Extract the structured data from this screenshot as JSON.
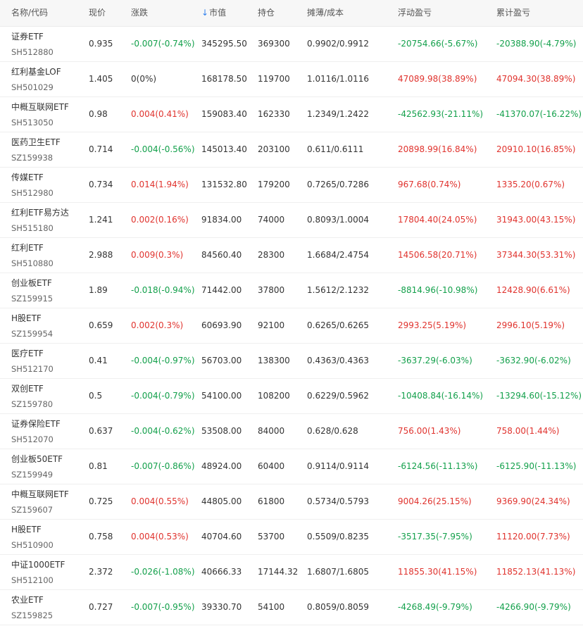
{
  "header": {
    "name_code": "名称/代码",
    "price": "现价",
    "change": "涨跌",
    "sort_arrow": "↓",
    "market_value": "市值",
    "position": "持仓",
    "cost": "摊薄/成本",
    "float_pl": "浮动盈亏",
    "total_pl": "累计盈亏"
  },
  "colors": {
    "up": "#e0332e",
    "down": "#13a04b",
    "sort_accent": "#2f80ed"
  },
  "rows": [
    {
      "name": "证券ETF",
      "code": "SH512880",
      "price": "0.935",
      "change": "-0.007(-0.74%)",
      "mv": "345295.50",
      "pos": "369300",
      "cost": "0.9902/0.9912",
      "float": "-20754.66(-5.67%)",
      "total": "-20388.90(-4.79%)",
      "cs": "neg",
      "fs": "neg",
      "ts": "neg"
    },
    {
      "name": "红利基金LOF",
      "code": "SH501029",
      "price": "1.405",
      "change": "0(0%)",
      "mv": "168178.50",
      "pos": "119700",
      "cost": "1.0116/1.0116",
      "float": "47089.98(38.89%)",
      "total": "47094.30(38.89%)",
      "cs": "flat",
      "fs": "pos",
      "ts": "pos"
    },
    {
      "name": "中概互联网ETF",
      "code": "SH513050",
      "price": "0.98",
      "change": "0.004(0.41%)",
      "mv": "159083.40",
      "pos": "162330",
      "cost": "1.2349/1.2422",
      "float": "-42562.93(-21.11%)",
      "total": "-41370.07(-16.22%)",
      "cs": "pos",
      "fs": "neg",
      "ts": "neg"
    },
    {
      "name": "医药卫生ETF",
      "code": "SZ159938",
      "price": "0.714",
      "change": "-0.004(-0.56%)",
      "mv": "145013.40",
      "pos": "203100",
      "cost": "0.611/0.6111",
      "float": "20898.99(16.84%)",
      "total": "20910.10(16.85%)",
      "cs": "neg",
      "fs": "pos",
      "ts": "pos"
    },
    {
      "name": "传媒ETF",
      "code": "SH512980",
      "price": "0.734",
      "change": "0.014(1.94%)",
      "mv": "131532.80",
      "pos": "179200",
      "cost": "0.7265/0.7286",
      "float": "967.68(0.74%)",
      "total": "1335.20(0.67%)",
      "cs": "pos",
      "fs": "pos",
      "ts": "pos"
    },
    {
      "name": "红利ETF易方达",
      "code": "SH515180",
      "price": "1.241",
      "change": "0.002(0.16%)",
      "mv": "91834.00",
      "pos": "74000",
      "cost": "0.8093/1.0004",
      "float": "17804.40(24.05%)",
      "total": "31943.00(43.15%)",
      "cs": "pos",
      "fs": "pos",
      "ts": "pos"
    },
    {
      "name": "红利ETF",
      "code": "SH510880",
      "price": "2.988",
      "change": "0.009(0.3%)",
      "mv": "84560.40",
      "pos": "28300",
      "cost": "1.6684/2.4754",
      "float": "14506.58(20.71%)",
      "total": "37344.30(53.31%)",
      "cs": "pos",
      "fs": "pos",
      "ts": "pos"
    },
    {
      "name": "创业板ETF",
      "code": "SZ159915",
      "price": "1.89",
      "change": "-0.018(-0.94%)",
      "mv": "71442.00",
      "pos": "37800",
      "cost": "1.5612/2.1232",
      "float": "-8814.96(-10.98%)",
      "total": "12428.90(6.61%)",
      "cs": "neg",
      "fs": "neg",
      "ts": "pos"
    },
    {
      "name": "H股ETF",
      "code": "SZ159954",
      "price": "0.659",
      "change": "0.002(0.3%)",
      "mv": "60693.90",
      "pos": "92100",
      "cost": "0.6265/0.6265",
      "float": "2993.25(5.19%)",
      "total": "2996.10(5.19%)",
      "cs": "pos",
      "fs": "pos",
      "ts": "pos"
    },
    {
      "name": "医疗ETF",
      "code": "SH512170",
      "price": "0.41",
      "change": "-0.004(-0.97%)",
      "mv": "56703.00",
      "pos": "138300",
      "cost": "0.4363/0.4363",
      "float": "-3637.29(-6.03%)",
      "total": "-3632.90(-6.02%)",
      "cs": "neg",
      "fs": "neg",
      "ts": "neg"
    },
    {
      "name": "双创ETF",
      "code": "SZ159780",
      "price": "0.5",
      "change": "-0.004(-0.79%)",
      "mv": "54100.00",
      "pos": "108200",
      "cost": "0.6229/0.5962",
      "float": "-10408.84(-16.14%)",
      "total": "-13294.60(-15.12%)",
      "cs": "neg",
      "fs": "neg",
      "ts": "neg"
    },
    {
      "name": "证券保险ETF",
      "code": "SH512070",
      "price": "0.637",
      "change": "-0.004(-0.62%)",
      "mv": "53508.00",
      "pos": "84000",
      "cost": "0.628/0.628",
      "float": "756.00(1.43%)",
      "total": "758.00(1.44%)",
      "cs": "neg",
      "fs": "pos",
      "ts": "pos"
    },
    {
      "name": "创业板50ETF",
      "code": "SZ159949",
      "price": "0.81",
      "change": "-0.007(-0.86%)",
      "mv": "48924.00",
      "pos": "60400",
      "cost": "0.9114/0.9114",
      "float": "-6124.56(-11.13%)",
      "total": "-6125.90(-11.13%)",
      "cs": "neg",
      "fs": "neg",
      "ts": "neg"
    },
    {
      "name": "中概互联网ETF",
      "code": "SZ159607",
      "price": "0.725",
      "change": "0.004(0.55%)",
      "mv": "44805.00",
      "pos": "61800",
      "cost": "0.5734/0.5793",
      "float": "9004.26(25.15%)",
      "total": "9369.90(24.34%)",
      "cs": "pos",
      "fs": "pos",
      "ts": "pos"
    },
    {
      "name": "H股ETF",
      "code": "SH510900",
      "price": "0.758",
      "change": "0.004(0.53%)",
      "mv": "40704.60",
      "pos": "53700",
      "cost": "0.5509/0.8235",
      "float": "-3517.35(-7.95%)",
      "total": "11120.00(7.73%)",
      "cs": "pos",
      "fs": "neg",
      "ts": "pos"
    },
    {
      "name": "中证1000ETF",
      "code": "SH512100",
      "price": "2.372",
      "change": "-0.026(-1.08%)",
      "mv": "40666.33",
      "pos": "17144.32",
      "cost": "1.6807/1.6805",
      "float": "11855.30(41.15%)",
      "total": "11852.13(41.13%)",
      "cs": "neg",
      "fs": "pos",
      "ts": "pos"
    },
    {
      "name": "农业ETF",
      "code": "SZ159825",
      "price": "0.727",
      "change": "-0.007(-0.95%)",
      "mv": "39330.70",
      "pos": "54100",
      "cost": "0.8059/0.8059",
      "float": "-4268.49(-9.79%)",
      "total": "-4266.90(-9.79%)",
      "cs": "neg",
      "fs": "neg",
      "ts": "neg"
    }
  ]
}
